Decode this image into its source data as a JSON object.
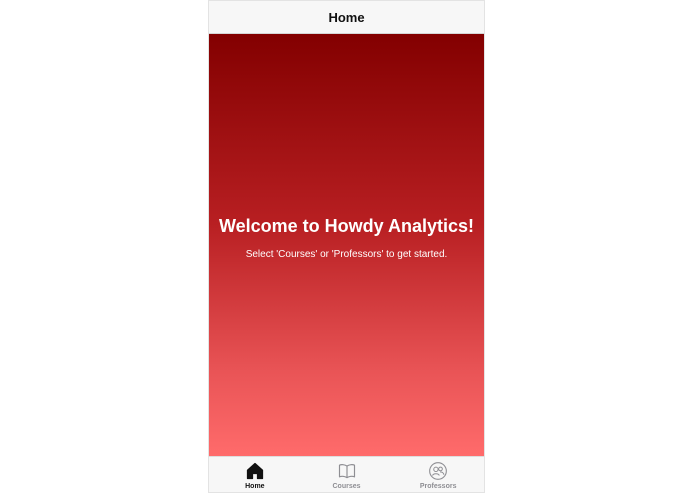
{
  "header": {
    "title": "Home"
  },
  "hero": {
    "title": "Welcome to Howdy Analytics!",
    "subtitle": "Select 'Courses' or 'Professors' to get started."
  },
  "tabs": [
    {
      "label": "Home",
      "icon": "home-icon",
      "active": true
    },
    {
      "label": "Courses",
      "icon": "book-icon",
      "active": false
    },
    {
      "label": "Professors",
      "icon": "people-icon",
      "active": false
    }
  ],
  "colors": {
    "gradient_top": "#830000",
    "gradient_bottom": "#ff6b6b",
    "active_tab": "#111111",
    "inactive_tab": "#8e8e93"
  }
}
